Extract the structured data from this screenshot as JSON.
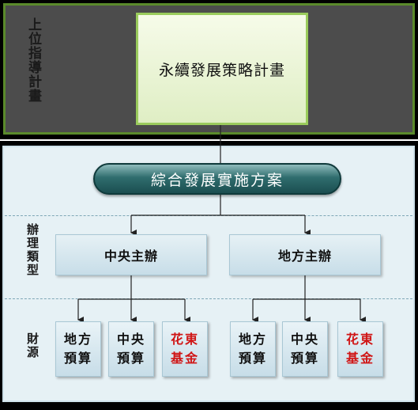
{
  "upper_label": "上位指導計畫",
  "plan_title": "永續發展策略計畫",
  "program_title": "綜合發展實施方案",
  "organizer_label": "辦理類型",
  "funding_label": "財源",
  "organizers": [
    {
      "label": "中央主辦",
      "funds": [
        {
          "line1": "地方",
          "line2": "預算",
          "highlight": false
        },
        {
          "line1": "中央",
          "line2": "預算",
          "highlight": false
        },
        {
          "line1": "花東",
          "line2": "基金",
          "highlight": true
        }
      ]
    },
    {
      "label": "地方主辦",
      "funds": [
        {
          "line1": "地方",
          "line2": "預算",
          "highlight": false
        },
        {
          "line1": "中央",
          "line2": "預算",
          "highlight": false
        },
        {
          "line1": "花東",
          "line2": "基金",
          "highlight": true
        }
      ]
    }
  ],
  "colors": {
    "highlight_text": "#d01515",
    "program_box": "#2f6d6e",
    "plan_border": "#9acb5c"
  }
}
